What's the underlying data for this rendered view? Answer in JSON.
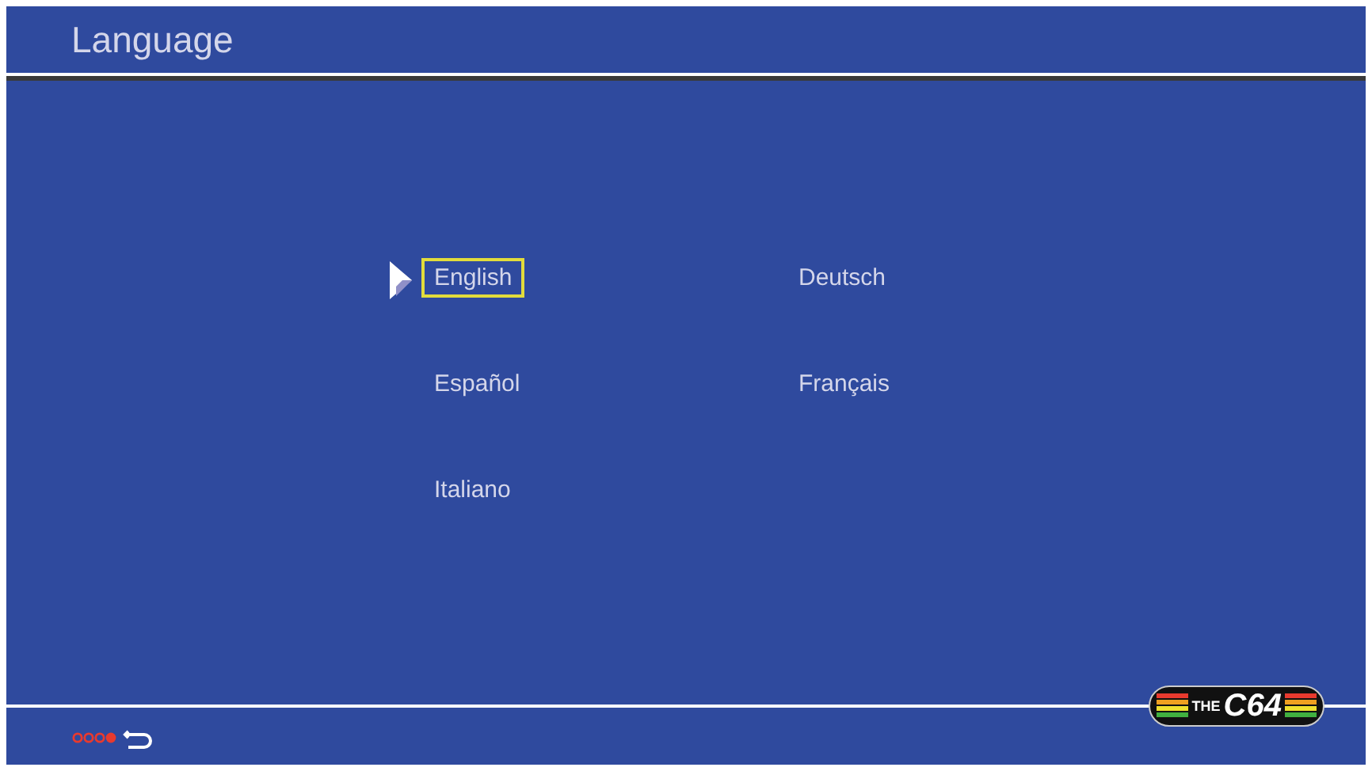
{
  "header": {
    "title": "Language"
  },
  "languages": [
    {
      "label": "English",
      "selected": true
    },
    {
      "label": "Deutsch",
      "selected": false
    },
    {
      "label": "Español",
      "selected": false
    },
    {
      "label": "Français",
      "selected": false
    },
    {
      "label": "Italiano",
      "selected": false
    }
  ],
  "logo": {
    "prefix": "THE",
    "name": "C64"
  }
}
